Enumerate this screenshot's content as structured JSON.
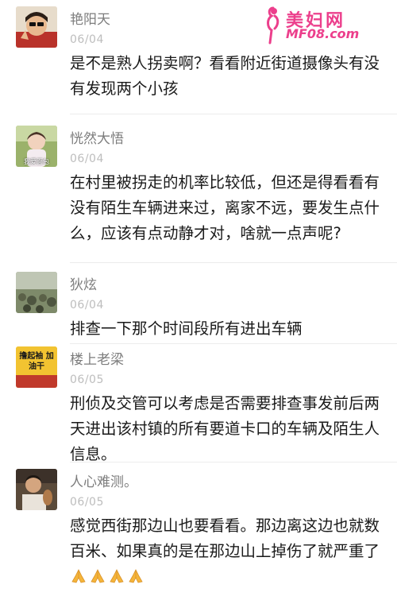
{
  "watermark": {
    "title": "美妇网",
    "url": "MF08.com"
  },
  "comments": [
    {
      "username": "艳阳天",
      "date": "06/04",
      "text": "是不是熟人拐卖啊？看看附近街道摄像头有没有发现两个小孩",
      "avatar_caption": ""
    },
    {
      "username": "恍然大悟",
      "date": "06/04",
      "text": "在村里被拐走的机率比较低，但还是得看看有没有陌生车辆进来过，离家不远，要发生点什么，应该有点动静才对，啥就一点声呢?",
      "avatar_caption": "我爱面包"
    },
    {
      "username": "狄炫",
      "date": "06/04",
      "text": "排查一下那个时间段所有进出车辆",
      "avatar_caption": ""
    },
    {
      "username": "楼上老梁",
      "date": "06/05",
      "text": "刑侦及交管可以考虑是否需要排查事发前后两天进出该村镇的所有要道卡口的车辆及陌生人信息。",
      "avatar_caption": "撸起袖 加油干"
    },
    {
      "username": "人心难测。",
      "date": "06/05",
      "text": "感觉西街那边山也要看看。那边离这边也就数百米、如果真的是在那边山上掉伤了就严重了",
      "avatar_caption": "",
      "emoji": [
        "folded-hands-icon",
        "folded-hands-icon",
        "folded-hands-icon",
        "folded-hands-icon"
      ]
    }
  ]
}
